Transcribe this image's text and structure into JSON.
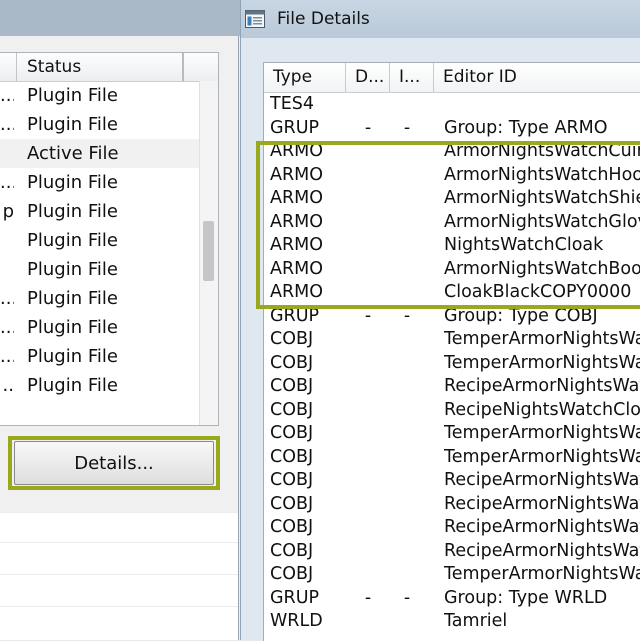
{
  "background_window": {
    "list_header": {
      "status_label": "Status"
    },
    "rows": [
      {
        "lead": "...",
        "status": "Plugin File",
        "active": false
      },
      {
        "lead": "...",
        "status": "Plugin File",
        "active": false
      },
      {
        "lead": "",
        "status": "Active File",
        "active": true
      },
      {
        "lead": "...",
        "status": "Plugin File",
        "active": false
      },
      {
        "lead": "p",
        "status": "Plugin File",
        "active": false
      },
      {
        "lead": "",
        "status": "Plugin File",
        "active": false
      },
      {
        "lead": "",
        "status": "Plugin File",
        "active": false
      },
      {
        "lead": "...",
        "status": "Plugin File",
        "active": false
      },
      {
        "lead": "...",
        "status": "Plugin File",
        "active": false
      },
      {
        "lead": "...",
        "status": "Plugin File",
        "active": false
      },
      {
        "lead": "..",
        "status": "Plugin File",
        "active": false
      }
    ],
    "details_button_label": "Details..."
  },
  "file_details_window": {
    "title": "File Details",
    "columns": {
      "type": "Type",
      "d": "D...",
      "i": "I...",
      "editor_id": "Editor ID"
    },
    "rows": [
      {
        "type": "TES4",
        "d": "",
        "i": "",
        "editor_id": ""
      },
      {
        "type": "GRUP",
        "d": "-",
        "i": "-",
        "editor_id": "Group: Type ARMO"
      },
      {
        "type": "ARMO",
        "d": "",
        "i": "",
        "editor_id": "ArmorNightsWatchCuirass"
      },
      {
        "type": "ARMO",
        "d": "",
        "i": "",
        "editor_id": "ArmorNightsWatchHood"
      },
      {
        "type": "ARMO",
        "d": "",
        "i": "",
        "editor_id": "ArmorNightsWatchShield"
      },
      {
        "type": "ARMO",
        "d": "",
        "i": "",
        "editor_id": "ArmorNightsWatchGloves"
      },
      {
        "type": "ARMO",
        "d": "",
        "i": "",
        "editor_id": "NightsWatchCloak"
      },
      {
        "type": "ARMO",
        "d": "",
        "i": "",
        "editor_id": "ArmorNightsWatchBoots"
      },
      {
        "type": "ARMO",
        "d": "",
        "i": "",
        "editor_id": "CloakBlackCOPY0000"
      },
      {
        "type": "GRUP",
        "d": "-",
        "i": "-",
        "editor_id": "Group: Type COBJ"
      },
      {
        "type": "COBJ",
        "d": "",
        "i": "",
        "editor_id": "TemperArmorNightsWatch"
      },
      {
        "type": "COBJ",
        "d": "",
        "i": "",
        "editor_id": "TemperArmorNightsWatch"
      },
      {
        "type": "COBJ",
        "d": "",
        "i": "",
        "editor_id": "RecipeArmorNightsWatch"
      },
      {
        "type": "COBJ",
        "d": "",
        "i": "",
        "editor_id": "RecipeNightsWatchCloak"
      },
      {
        "type": "COBJ",
        "d": "",
        "i": "",
        "editor_id": "TemperArmorNightsWatch"
      },
      {
        "type": "COBJ",
        "d": "",
        "i": "",
        "editor_id": "TemperArmorNightsWatch"
      },
      {
        "type": "COBJ",
        "d": "",
        "i": "",
        "editor_id": "RecipeArmorNightsWatch"
      },
      {
        "type": "COBJ",
        "d": "",
        "i": "",
        "editor_id": "RecipeArmorNightsWatch"
      },
      {
        "type": "COBJ",
        "d": "",
        "i": "",
        "editor_id": "RecipeArmorNightsWatch"
      },
      {
        "type": "COBJ",
        "d": "",
        "i": "",
        "editor_id": "RecipeArmorNightsWatch"
      },
      {
        "type": "COBJ",
        "d": "",
        "i": "",
        "editor_id": "TemperArmorNightsWatch"
      },
      {
        "type": "GRUP",
        "d": "-",
        "i": "-",
        "editor_id": "Group: Type WRLD"
      },
      {
        "type": "WRLD",
        "d": "",
        "i": "",
        "editor_id": "Tamriel"
      }
    ]
  },
  "colors": {
    "highlight": "#9aa81d",
    "titlebar": "#b9c9d9"
  }
}
